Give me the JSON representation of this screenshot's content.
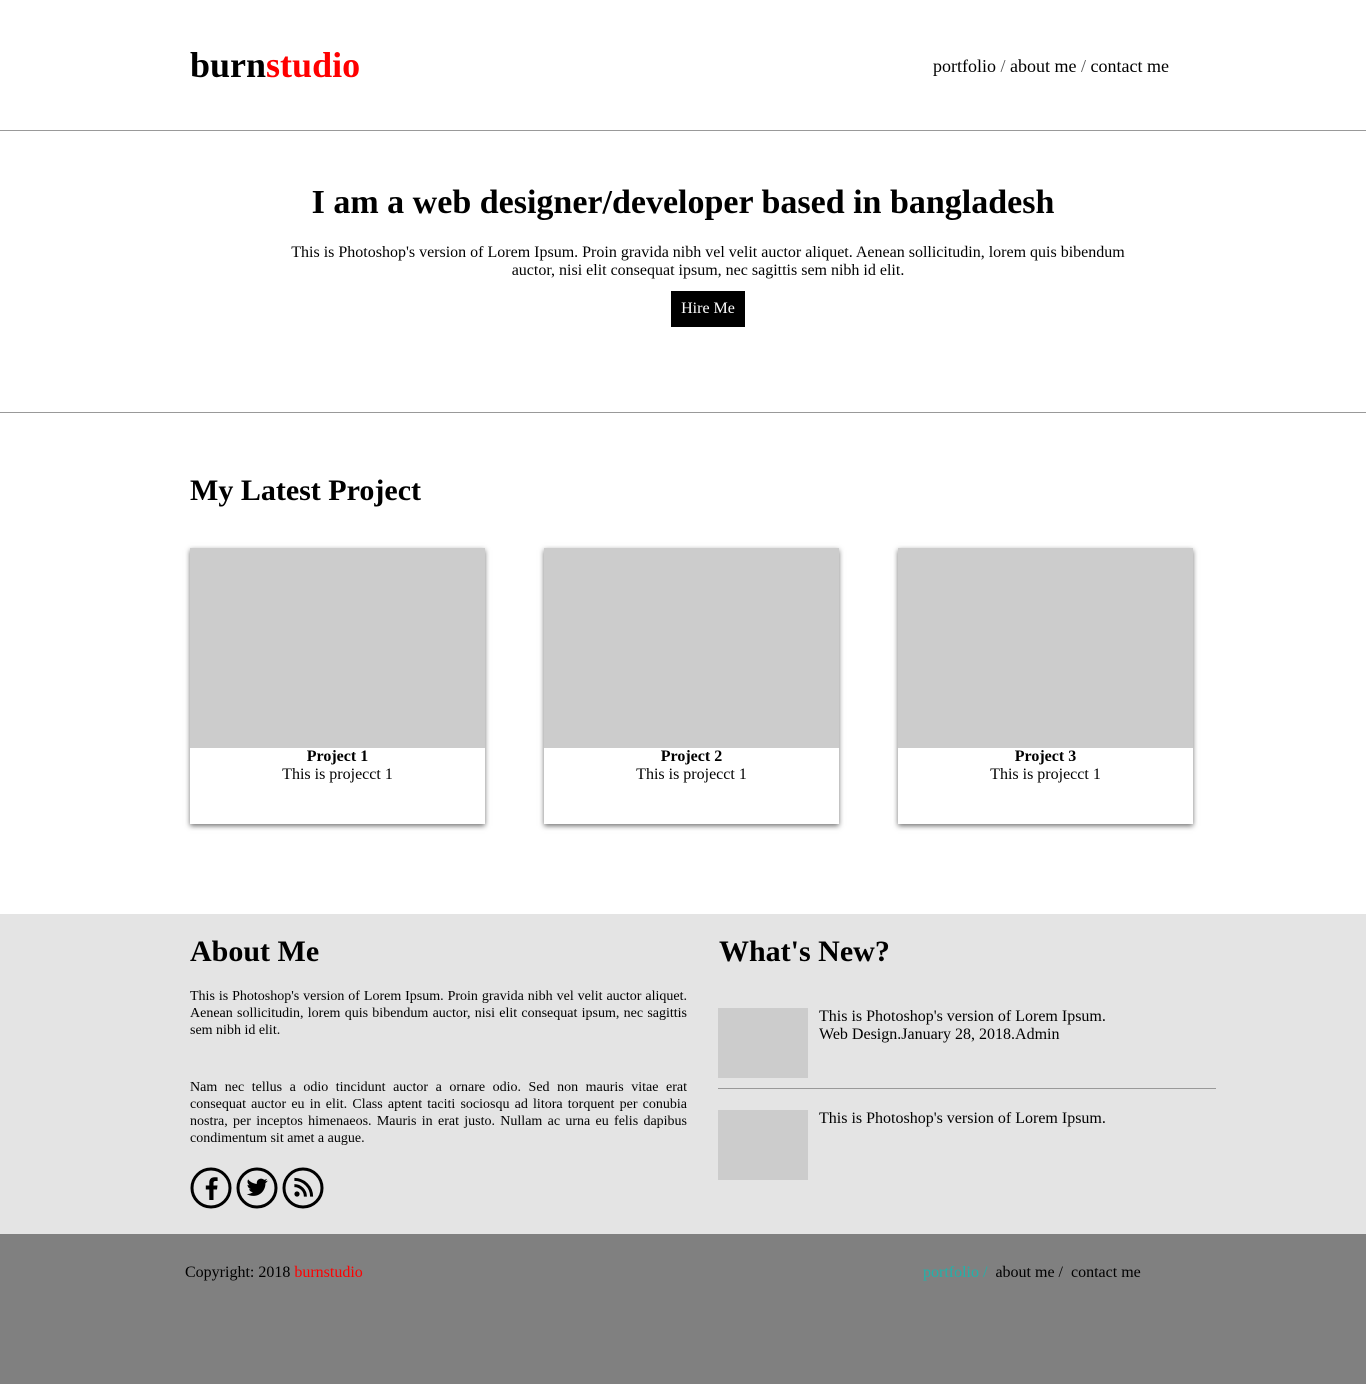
{
  "header": {
    "logo_part1": "burn",
    "logo_part2": "studio",
    "nav": [
      "portfolio",
      "about me",
      "contact me"
    ],
    "separator": " / "
  },
  "hero": {
    "title": "I am a web designer/developer based in bangladesh",
    "text": "This is Photoshop's version of Lorem Ipsum. Proin gravida nibh vel velit auctor aliquet. Aenean sollicitudin, lorem quis bibendum auctor, nisi elit consequat ipsum, nec sagittis sem nibh id elit.",
    "button": "Hire Me"
  },
  "projects": {
    "title": "My Latest Project",
    "items": [
      {
        "title": "Project 1",
        "desc": "This is projecct 1"
      },
      {
        "title": "Project 2",
        "desc": "This is projecct 1"
      },
      {
        "title": "Project 3",
        "desc": "This is projecct 1"
      }
    ]
  },
  "about": {
    "title": "About Me",
    "p1": "This is Photoshop's version of Lorem Ipsum. Proin gravida nibh vel velit auctor aliquet. Aenean sollicitudin, lorem quis bibendum auctor, nisi elit consequat ipsum, nec sagittis sem nibh id elit.",
    "p2": "Nam nec tellus a odio tincidunt auctor a ornare odio. Sed non mauris vitae erat consequat auctor eu in elit. Class aptent taciti sociosqu ad litora torquent per conubia nostra, per inceptos himenaeos. Mauris in erat justo. Nullam ac urna eu felis dapibus condimentum sit amet a augue.",
    "socials": [
      "facebook-icon",
      "twitter-icon",
      "rss-icon"
    ]
  },
  "whats_new": {
    "title": "What's New?",
    "items": [
      {
        "line1": "This is Photoshop's version of Lorem Ipsum.",
        "line2": "Web Design.January 28, 2018.Admin"
      },
      {
        "line1": "This is Photoshop's version of Lorem Ipsum.",
        "line2": ""
      }
    ]
  },
  "footer": {
    "copyright": "Copyright: 2018 ",
    "brand": "burnstudio",
    "nav": [
      "portfolio",
      "about me",
      "contact me"
    ],
    "separator": " / "
  },
  "colors": {
    "brand_red": "#ff0000",
    "footer_active": "#20b2aa",
    "info_bg": "#e4e4e4",
    "footer_bg": "#808080",
    "placeholder": "#cccccc"
  }
}
